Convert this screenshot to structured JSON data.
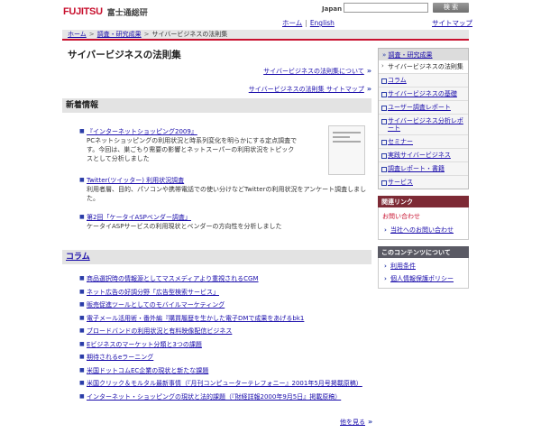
{
  "header": {
    "logo_text": "FUJITSU",
    "logo_jp": "富士通総研",
    "lang_label": "Japan",
    "search_button": "検 索",
    "nav_home": "ホーム",
    "nav_sep": "|",
    "nav_english": "English",
    "sitemap": "サイトマップ"
  },
  "breadcrumb": {
    "items": [
      "ホーム",
      "調査・研究成果",
      "サイバービジネスの法則集"
    ],
    "sep": ">"
  },
  "main": {
    "title": "サイバービジネスの法則集",
    "intro_links": [
      "サイバービジネスの法則集について",
      "サイバービジネスの法則集 サイトマップ"
    ],
    "news_heading": "新着情報",
    "news": [
      {
        "title": "『インターネットショッピング2009』",
        "desc": "PCネットショッピングの利用状況と時系列変化を明らかにする定点調査です。今回は、巣ごもり需要の影響とネットスーパーの利用状況をトピックスとして分析しました"
      },
      {
        "title": "Twitter(ツイッター) 利用状況調査",
        "desc": "利用者層、目的、パソコンや携帯電話での使い分けなどTwitterの利用状況をアンケート調査しました。"
      },
      {
        "title": "第2回「ケータイASPベンダー調査」",
        "desc": "ケータイASPサービスの利用現状とベンダーの方向性を分析しました"
      }
    ],
    "column_heading": "コラム",
    "columns": [
      "商品選択時の情報源としてマスメディアより重視されるCGM",
      "ネット広告の好調分野「広告型検索サービス」",
      "販売促進ツールとしてのモバイルマーケティング",
      "電子メール活用術・番外編『購買履歴を生かした電子DMで成果をあげるbk1",
      "ブロードバンドの利用状況と有料映像配信ビジネス",
      "Eビジネスのマーケット分類と3つの課題",
      "期待されるeラーニング",
      "米国ドットコムEC企業の現状と新たな課題",
      "米国クリック＆モルタル最新事情（『月刊コンピューターテレフォニー』2001年5月号掲載原稿）",
      "インターネット・ショッピングの現状と法的課題（『財経詳報2000年9月5日』掲載原稿）"
    ],
    "more": "他を見る"
  },
  "sidebar": {
    "nav_head": "調査・研究成果",
    "nav_current": "サイバービジネスの法則集",
    "nav_items": [
      "コラム",
      "サイバービジネスの基礎",
      "ユーザー調査レポート",
      "サイバービジネス分析レポート",
      "セミナー",
      "実践サイバービジネス",
      "調査レポート・書籍",
      "サービス"
    ],
    "related_head": "関連リンク",
    "related_sub": "お問い合わせ",
    "related_links": [
      "当社へのお問い合わせ"
    ],
    "content_head": "このコンテンツについて",
    "content_links": [
      "利用条件",
      "個人情報保護ポリシー"
    ]
  }
}
